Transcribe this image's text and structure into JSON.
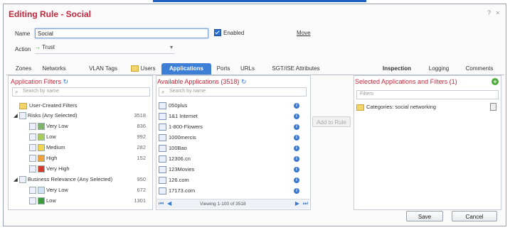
{
  "dialog": {
    "title": "Editing Rule - Social",
    "help": "?",
    "close": "×"
  },
  "form": {
    "name_label": "Name",
    "name_value": "Social",
    "enabled_label": "Enabled",
    "move_label": "Move",
    "action_label": "Action",
    "action_value": "Trust"
  },
  "tabs": [
    {
      "label": "Zones"
    },
    {
      "label": "Networks"
    },
    {
      "label": "VLAN Tags"
    },
    {
      "label": "Users"
    },
    {
      "label": "Applications"
    },
    {
      "label": "Ports"
    },
    {
      "label": "URLs"
    },
    {
      "label": "SGT/ISE Attributes"
    },
    {
      "label": "Inspection"
    },
    {
      "label": "Logging"
    },
    {
      "label": "Comments"
    }
  ],
  "filters": {
    "title": "Application Filters",
    "search_placeholder": "Search by name",
    "items": [
      {
        "label": "User-Created Filters",
        "count": ""
      },
      {
        "label": "Risks (Any Selected)",
        "count": "3518"
      },
      {
        "label": "Very Low",
        "count": "836"
      },
      {
        "label": "Low",
        "count": "992"
      },
      {
        "label": "Medium",
        "count": "282"
      },
      {
        "label": "High",
        "count": "152"
      },
      {
        "label": "Very High",
        "count": ""
      },
      {
        "label": "Business Relevance (Any Selected)",
        "count": "950"
      },
      {
        "label": "Very Low",
        "count": "672"
      },
      {
        "label": "Low",
        "count": "1301"
      }
    ]
  },
  "available": {
    "title": "Available Applications (3518)",
    "search_placeholder": "Search by name",
    "apps": [
      "050plus",
      "1&1 Internet",
      "1-800-Flowers",
      "1000mercis",
      "100Bao",
      "12306.cn",
      "123Movies",
      "126.com",
      "17173.com"
    ],
    "pager": "Viewing 1-100 of 3518",
    "add_to_rule": "Add to Rule"
  },
  "selected": {
    "title": "Selected Applications and Filters (1)",
    "filters_placeholder": "Filters",
    "items": [
      "Categories: social networking"
    ]
  },
  "footer": {
    "save": "Save",
    "cancel": "Cancel"
  },
  "colors": {
    "accent": "#3d7fd6",
    "title_red": "#c2283b"
  }
}
